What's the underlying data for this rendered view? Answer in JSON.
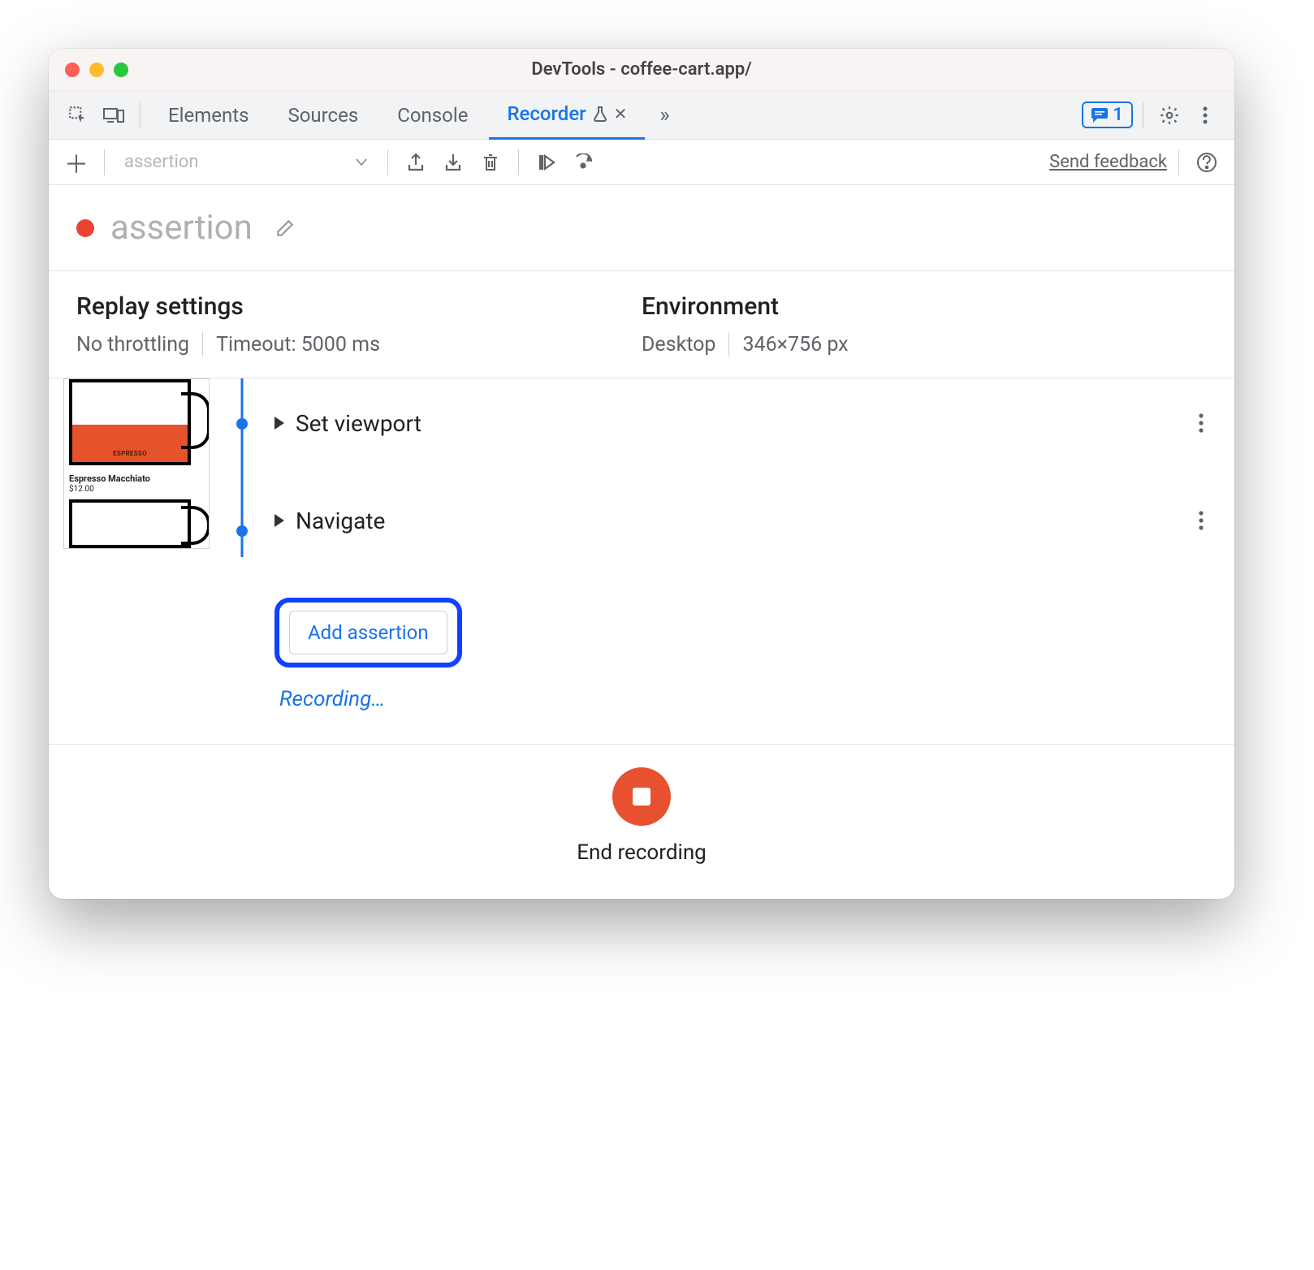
{
  "window_title": "DevTools - coffee-cart.app/",
  "tabs": [
    "Elements",
    "Sources",
    "Console",
    "Recorder"
  ],
  "active_tab_index": 3,
  "feedback_badge_count": "1",
  "toolbar": {
    "recording_selector_value": "assertion",
    "send_feedback": "Send feedback"
  },
  "recording": {
    "name": "assertion"
  },
  "replay_settings": {
    "heading": "Replay settings",
    "throttling": "No throttling",
    "timeout": "Timeout: 5000 ms"
  },
  "environment": {
    "heading": "Environment",
    "device": "Desktop",
    "dimensions": "346×756 px"
  },
  "thumbnail": {
    "product_name": "Espresso Macchiato",
    "product_price": "$12.00",
    "cup_label": "ESPRESSO"
  },
  "steps": [
    {
      "label": "Set viewport"
    },
    {
      "label": "Navigate"
    }
  ],
  "add_assertion_label": "Add assertion",
  "recording_status": "Recording…",
  "footer": {
    "end_recording": "End recording"
  }
}
